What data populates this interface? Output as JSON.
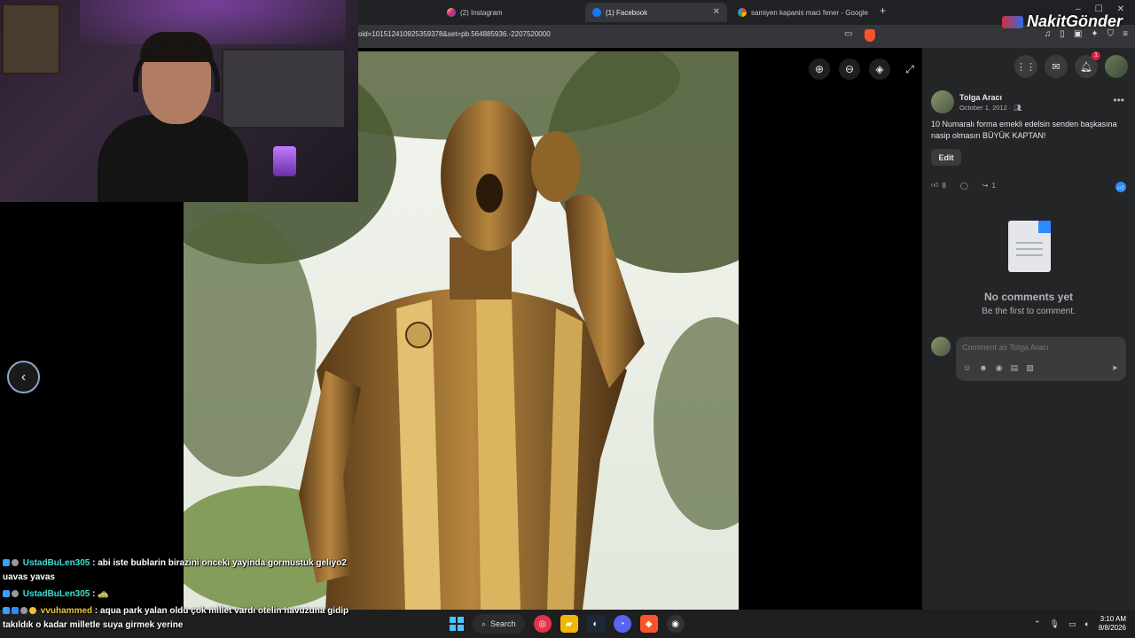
{
  "browser": {
    "tabs": [
      {
        "label": "(2) Instagram",
        "active": false
      },
      {
        "label": "(1) Facebook",
        "active": true
      },
      {
        "label": "samiyen kapanis maci fener - Google",
        "active": false
      }
    ],
    "url": "oid=101512410925359378&set=pb.564885936.-2207520000"
  },
  "watermark": {
    "text": "NakitGönder"
  },
  "viewer": {
    "prev_icon": "chevron-left-icon",
    "tools": [
      "zoom-in-icon",
      "zoom-out-icon",
      "tag-icon",
      "fullscreen-icon"
    ]
  },
  "facebook": {
    "notification_count": "1",
    "post": {
      "author": "Tolga Aracı",
      "date": "October 1, 2012 · ",
      "text": "10 Numaralı forma emekli edelsin senden başkasına nasip olmasın BÜYÜK KAPTAN!",
      "edit_label": "Edit",
      "likes": "8",
      "shares": "1"
    },
    "comments": {
      "empty_title": "No comments yet",
      "empty_subtitle": "Be the first to comment.",
      "placeholder": "Comment as Tolga Aracı"
    }
  },
  "chat": [
    {
      "user": "UstadBuLen305",
      "message": ": abi iste bublarin birazini onceki yayinda gormustuk geliyo2 uavas yavas"
    },
    {
      "user": "UstadBuLen305",
      "message": ": 🚕"
    },
    {
      "user": "vvuhammed",
      "message": ": aqua park yalan oldu çok millet vardı otelin havuzuna gidip takıldık o kadar milletle suya girmek yerine"
    }
  ],
  "taskbar": {
    "search_label": "Search",
    "time": "3:10 AM",
    "date": "8/8/2026"
  },
  "colors": {
    "fb_panel": "#242526",
    "fb_blue": "#2e89ff",
    "chat_user": "#3ce0d2",
    "chat_user_alt": "#f1c33d"
  }
}
